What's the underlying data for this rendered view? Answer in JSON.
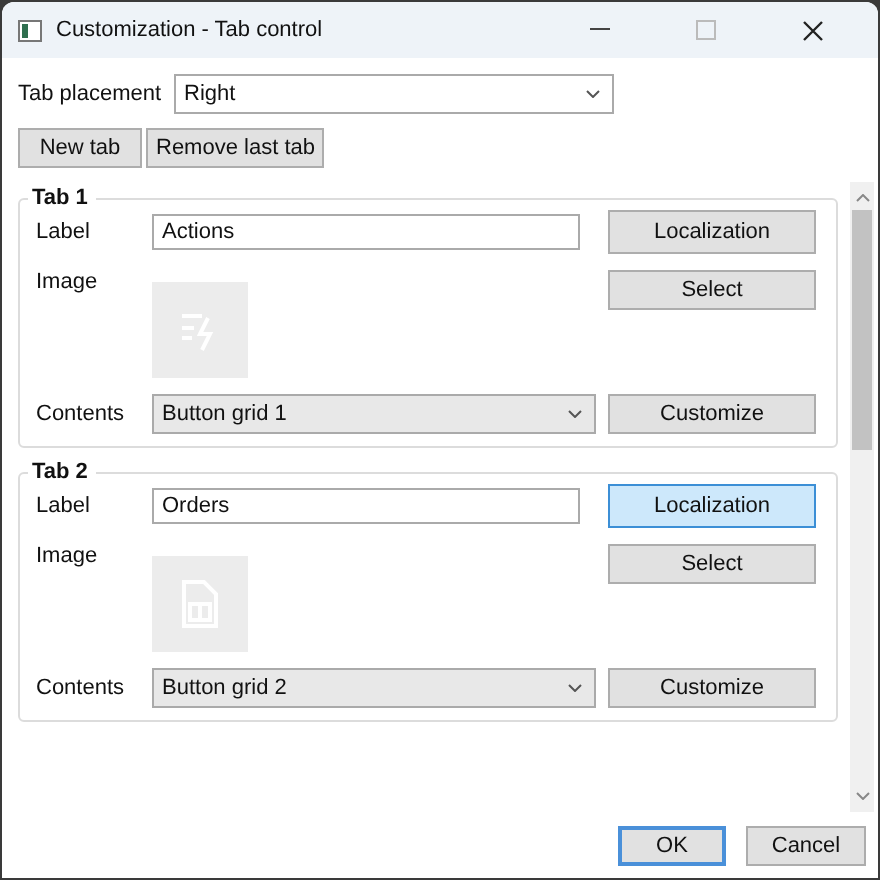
{
  "window": {
    "title": "Customization - Tab control"
  },
  "placement": {
    "label": "Tab placement",
    "value": "Right"
  },
  "actions": [
    {
      "label": "New tab"
    },
    {
      "label": "Remove last tab"
    }
  ],
  "tabs": [
    {
      "title": "Tab 1",
      "label_caption": "Label",
      "label_value": "Actions",
      "image_caption": "Image",
      "image": {
        "kind": "bolt"
      },
      "contents_caption": "Contents",
      "contents_value": "Button grid 1",
      "buttons": [
        {
          "label": "Localization",
          "hovered": false
        },
        {
          "label": "Select",
          "hovered": false
        },
        {
          "label": "Customize",
          "hovered": false
        }
      ]
    },
    {
      "title": "Tab 2",
      "label_caption": "Label",
      "label_value": "Orders",
      "image_caption": "Image",
      "image": {
        "kind": "document"
      },
      "contents_caption": "Contents",
      "contents_value": "Button grid 2",
      "buttons": [
        {
          "label": "Localization",
          "hovered": true
        },
        {
          "label": "Select",
          "hovered": false
        },
        {
          "label": "Customize",
          "hovered": false
        }
      ]
    }
  ],
  "footer": [
    {
      "label": "OK",
      "default": true
    },
    {
      "label": "Cancel",
      "default": false
    }
  ]
}
